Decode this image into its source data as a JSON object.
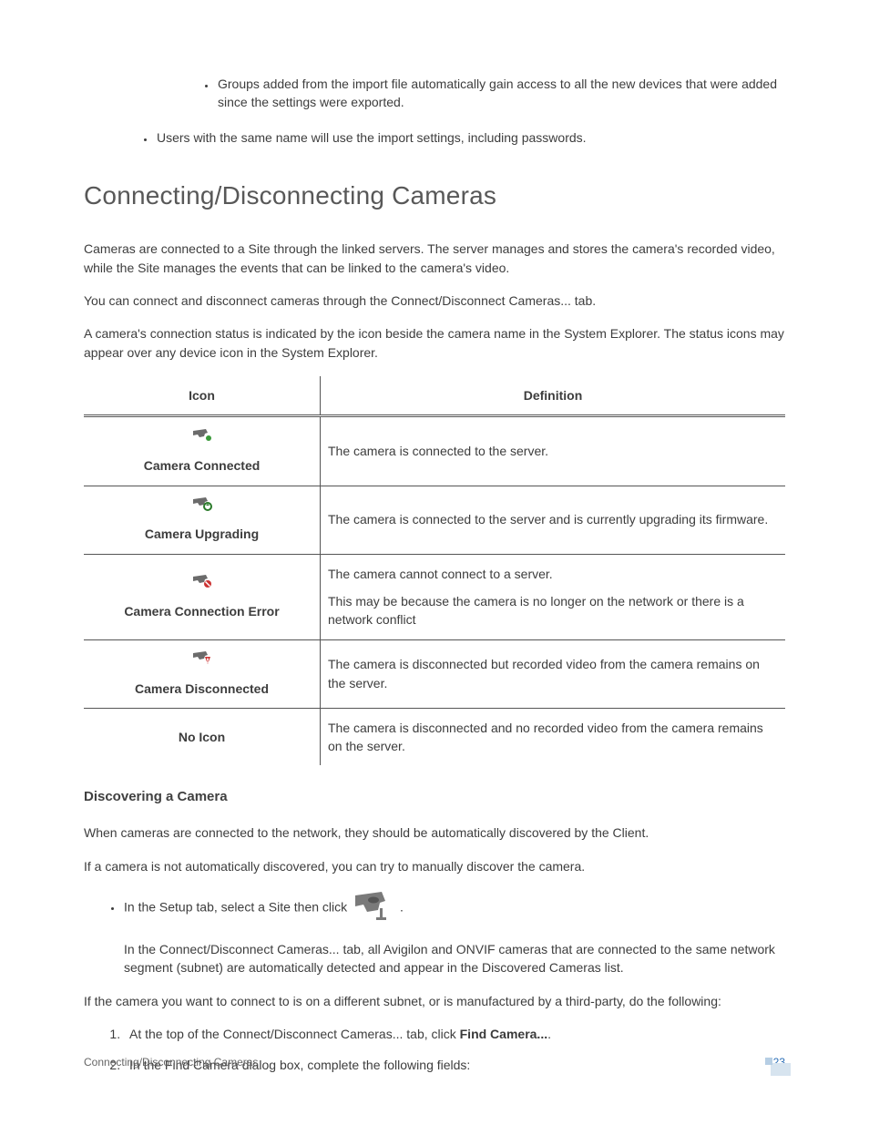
{
  "intro_bullets": {
    "level3_item": "Groups added from the import file automatically gain access to all the new devices that were added since the settings were exported.",
    "level2_item": "Users with the same name will use the import settings, including passwords."
  },
  "heading": "Connecting/Disconnecting Cameras",
  "paragraphs": {
    "p1": "Cameras are connected to a Site through the linked servers. The server manages and stores the camera's recorded video, while the Site manages the events that can be linked to the camera's video.",
    "p2": "You can connect and disconnect cameras through the Connect/Disconnect Cameras... tab.",
    "p3": "A camera's connection status is indicated by the icon beside the camera name in the System Explorer. The status icons may appear over any device icon in the System Explorer."
  },
  "table": {
    "headers": {
      "icon": "Icon",
      "definition": "Definition"
    },
    "rows": [
      {
        "label": "Camera Connected",
        "definition": "The camera is connected to the server."
      },
      {
        "label": "Camera Upgrading",
        "definition": "The camera is connected to the server and is currently upgrading its firmware."
      },
      {
        "label": "Camera Connection Error",
        "def_line1": "The camera cannot connect to a server.",
        "def_line2": "This may be because the camera is no longer on the network or there is a network conflict"
      },
      {
        "label": "Camera Disconnected",
        "definition": "The camera is disconnected but recorded video from the camera remains on the server."
      },
      {
        "label": "No Icon",
        "definition": "The camera is disconnected and no recorded video from the camera remains on the server."
      }
    ]
  },
  "subhead": "Discovering a Camera",
  "discover": {
    "p1": "When cameras are connected to the network, they should be automatically discovered by the Client.",
    "p2": "If a camera is not automatically discovered, you can try to manually discover the camera.",
    "bullet_prefix": "In the Setup tab, select a Site then click ",
    "bullet_suffix": ".",
    "bullet_follow": "In the Connect/Disconnect Cameras... tab, all Avigilon and ONVIF cameras that are connected to the same network segment (subnet) are automatically detected and appear in the Discovered Cameras list.",
    "p3": "If the camera you want to connect to is on a different subnet, or is manufactured by a third-party, do the following:",
    "ol1_prefix": "At the top of the Connect/Disconnect Cameras... tab, click ",
    "ol1_bold": "Find Camera...",
    "ol1_suffix": ".",
    "ol2": "In the Find Camera dialog box, complete the following fields:"
  },
  "footer": {
    "title": "Connecting/Disconnecting Cameras",
    "page": "23"
  }
}
